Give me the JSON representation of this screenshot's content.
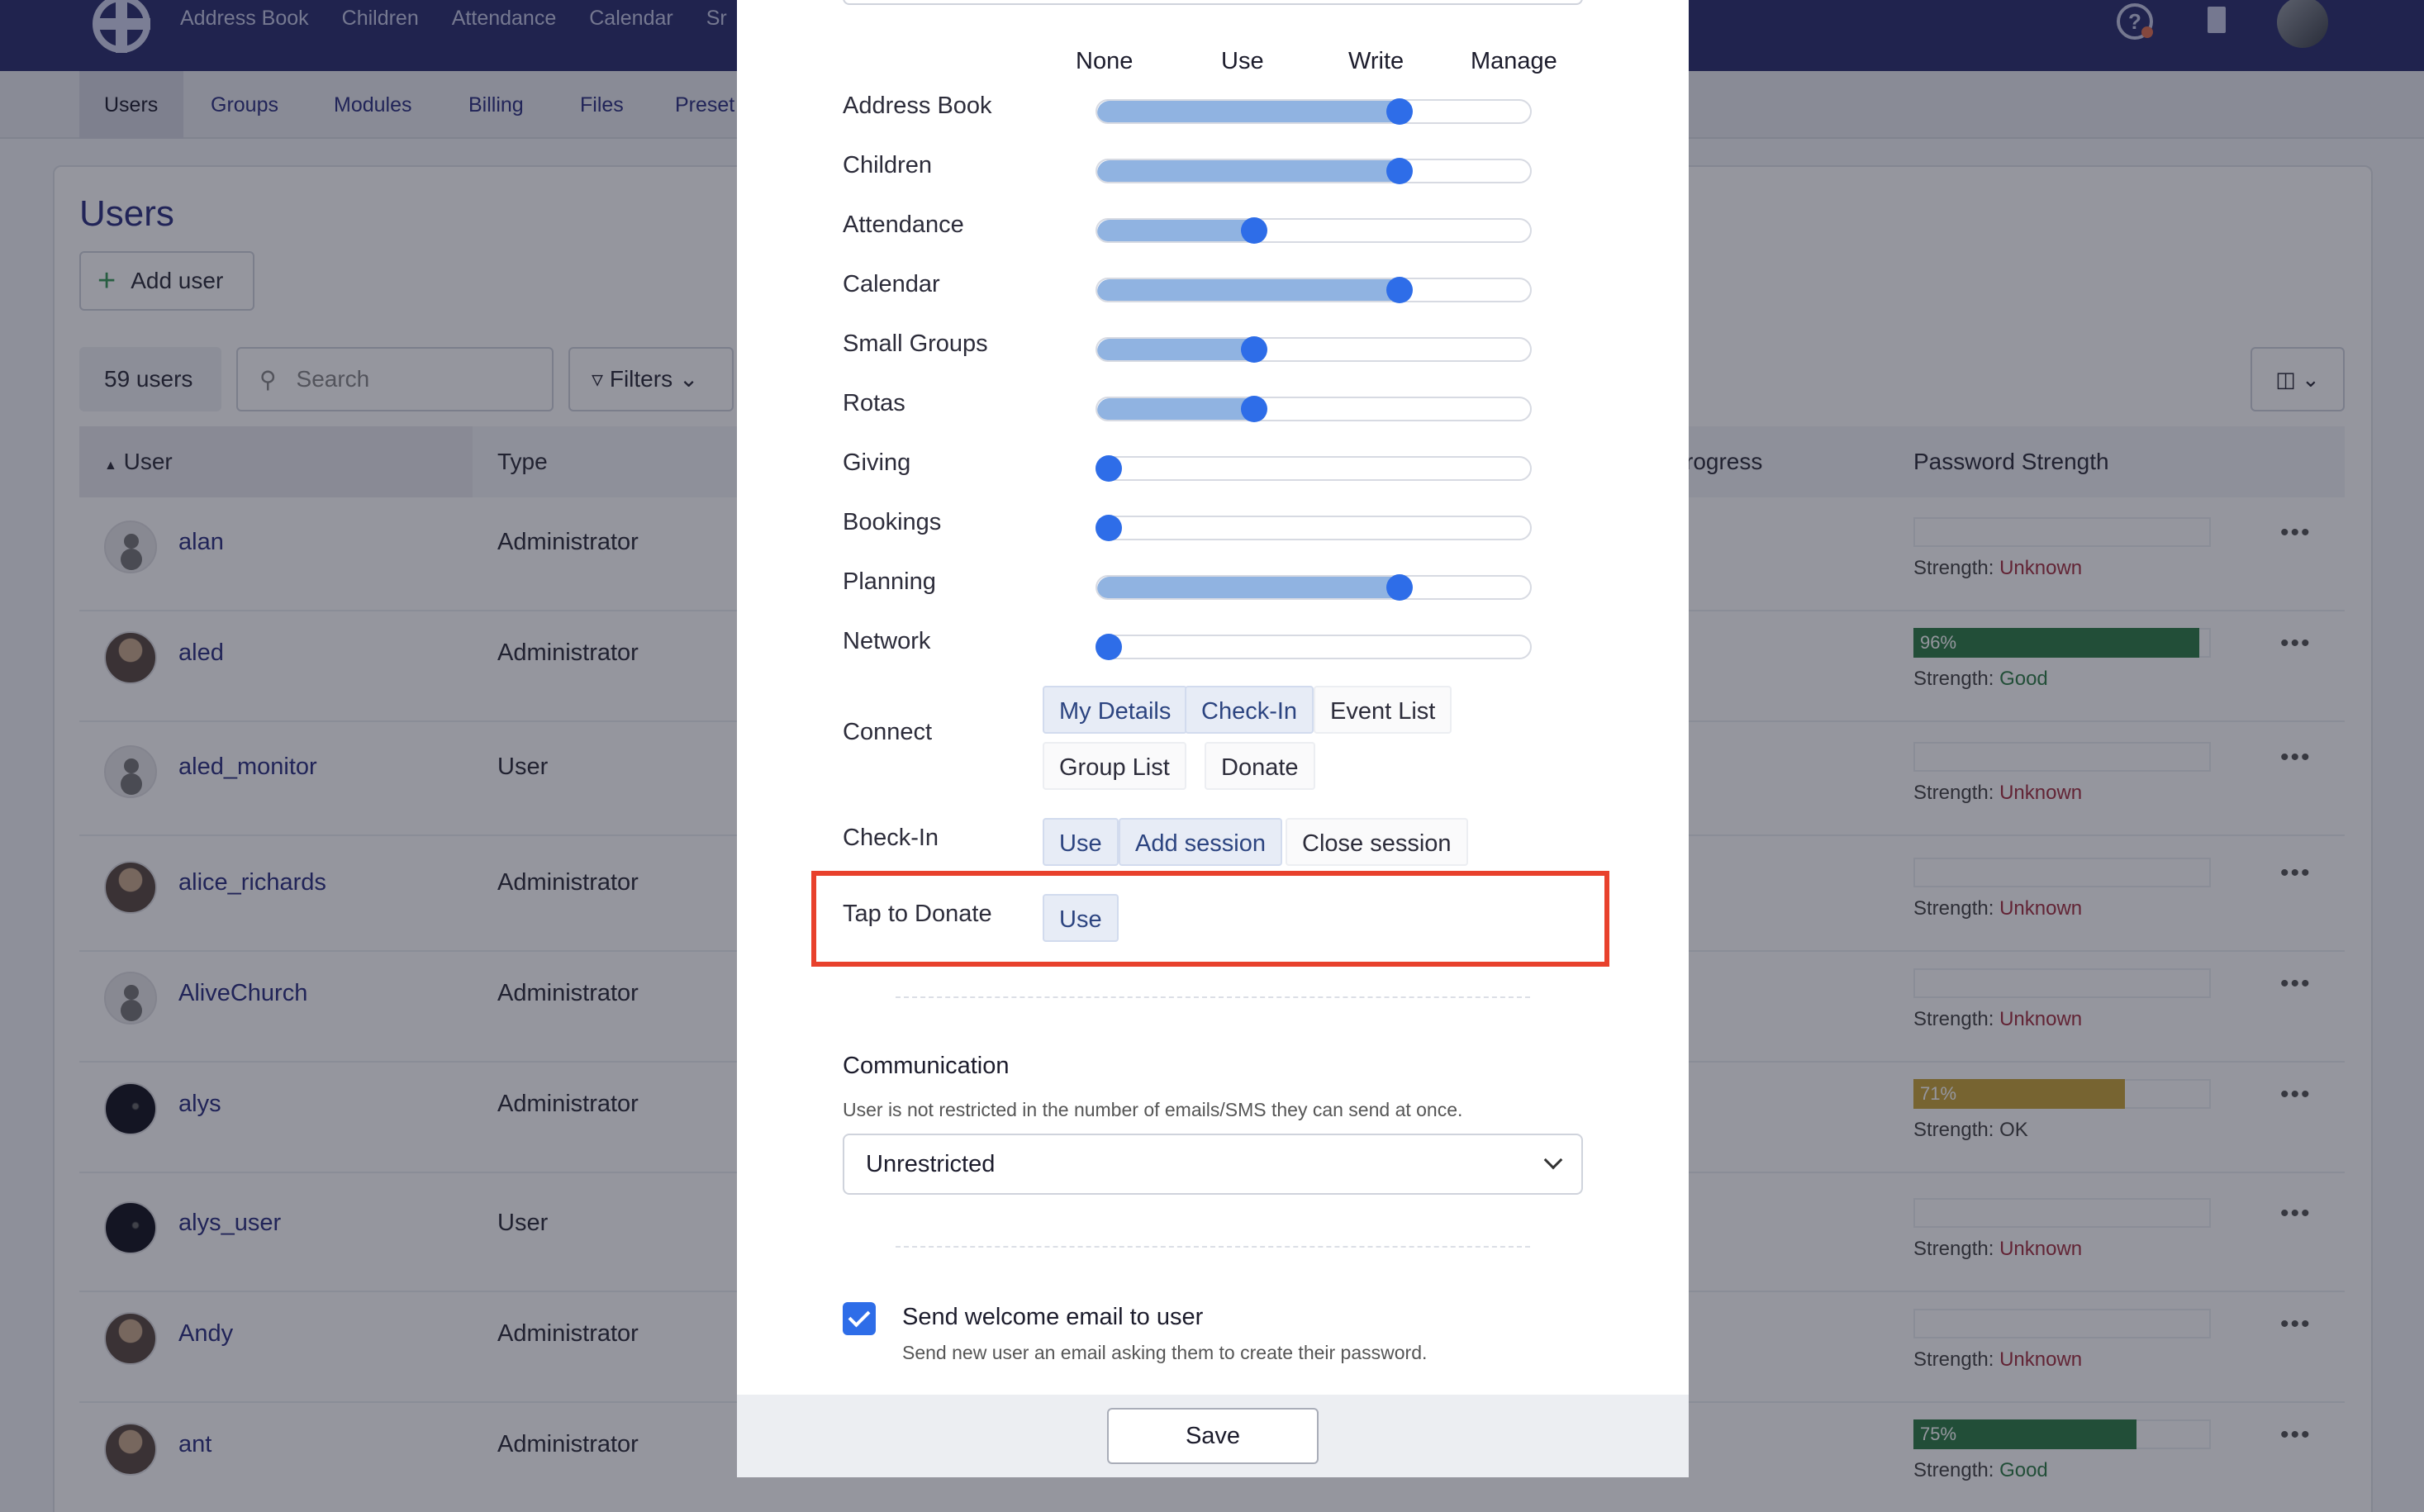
{
  "topnav": [
    "Address Book",
    "Children",
    "Attendance",
    "Calendar",
    "Sr"
  ],
  "subnav": [
    "Users",
    "Groups",
    "Modules",
    "Billing",
    "Files",
    "Preset"
  ],
  "users_panel": {
    "title": "Users",
    "add_user": "Add user",
    "count": "59 users",
    "search_placeholder": "Search",
    "filters": "Filters",
    "col_user": "User",
    "col_type": "Type",
    "col_progress": "rogress",
    "col_password": "Password Strength",
    "strength_prefix": "Strength:"
  },
  "users": [
    {
      "name": "alan",
      "type": "Administrator",
      "avatar": "plain",
      "strength": "Unknown",
      "pct": null
    },
    {
      "name": "aled",
      "type": "Administrator",
      "avatar": "photo",
      "strength": "Good",
      "pct": 96,
      "pct_label": "96%",
      "bar_color": "#2e7d46"
    },
    {
      "name": "aled_monitor",
      "type": "User",
      "avatar": "plain",
      "strength": "Unknown",
      "pct": null
    },
    {
      "name": "alice_richards",
      "type": "Administrator",
      "avatar": "photo",
      "strength": "Unknown",
      "pct": null
    },
    {
      "name": "AliveChurch",
      "type": "Administrator",
      "avatar": "plain",
      "strength": "Unknown",
      "pct": null
    },
    {
      "name": "alys",
      "type": "Administrator",
      "avatar": "dark",
      "strength": "OK",
      "pct": 71,
      "pct_label": "71%",
      "bar_color": "#c9a43a"
    },
    {
      "name": "alys_user",
      "type": "User",
      "avatar": "dark",
      "strength": "Unknown",
      "pct": null
    },
    {
      "name": "Andy",
      "type": "Administrator",
      "avatar": "photo",
      "strength": "Unknown",
      "pct": null
    },
    {
      "name": "ant",
      "type": "Administrator",
      "avatar": "photo",
      "strength": "Good",
      "pct": 75,
      "pct_label": "75%",
      "bar_color": "#2e7d46"
    }
  ],
  "modal": {
    "levels": [
      "None",
      "Use",
      "Write",
      "Manage"
    ],
    "permissions": [
      {
        "label": "Address Book",
        "level": 2
      },
      {
        "label": "Children",
        "level": 2
      },
      {
        "label": "Attendance",
        "level": 1
      },
      {
        "label": "Calendar",
        "level": 2
      },
      {
        "label": "Small Groups",
        "level": 1
      },
      {
        "label": "Rotas",
        "level": 1
      },
      {
        "label": "Giving",
        "level": 0
      },
      {
        "label": "Bookings",
        "level": 0
      },
      {
        "label": "Planning",
        "level": 2
      },
      {
        "label": "Network",
        "level": 0
      }
    ],
    "connect": {
      "label": "Connect",
      "options": [
        {
          "label": "My Details",
          "on": true
        },
        {
          "label": "Check-In",
          "on": true
        },
        {
          "label": "Event List",
          "on": false
        },
        {
          "label": "Group List",
          "on": false
        },
        {
          "label": "Donate",
          "on": false
        }
      ]
    },
    "checkin": {
      "label": "Check-In",
      "options": [
        {
          "label": "Use",
          "on": true
        },
        {
          "label": "Add session",
          "on": true
        },
        {
          "label": "Close session",
          "on": false
        }
      ]
    },
    "tap_to_donate": {
      "label": "Tap to Donate",
      "options": [
        {
          "label": "Use",
          "on": true
        }
      ]
    },
    "communication": {
      "title": "Communication",
      "description": "User is not restricted in the number of emails/SMS they can send at once.",
      "selected": "Unrestricted"
    },
    "welcome": {
      "checked": true,
      "label": "Send welcome email to user",
      "description": "Send new user an email asking them to create their password."
    },
    "save": "Save"
  },
  "colors": {
    "topbar": "#2a2f6e",
    "accent": "#2e6de8",
    "slider_fill": "#90b3e1",
    "highlight": "#e8412c"
  }
}
